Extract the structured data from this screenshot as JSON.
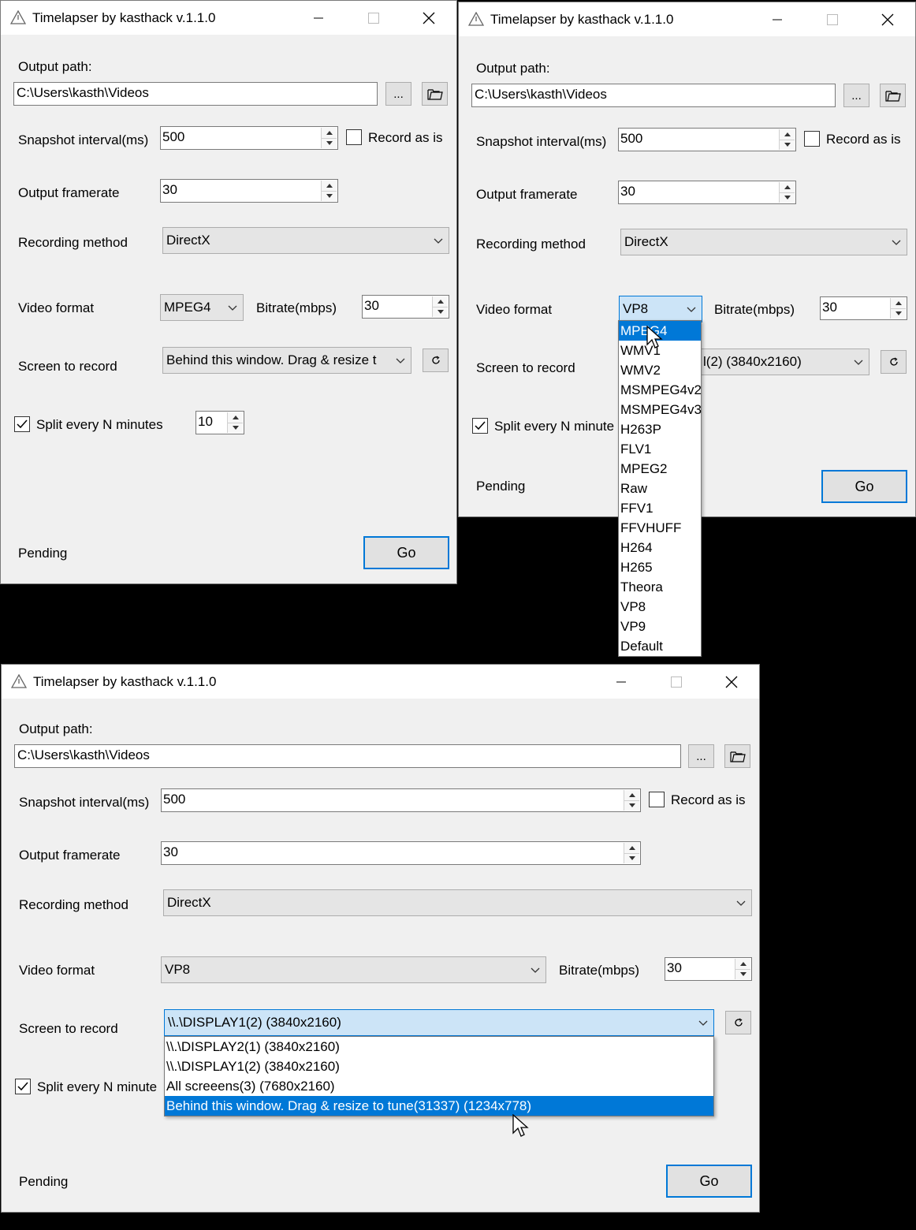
{
  "window_title": "Timelapser by kasthack v.1.1.0",
  "labels": {
    "output_path": "Output path:",
    "snapshot_interval": "Snapshot interval(ms)",
    "record_as_is": "Record as is",
    "output_framerate": "Output framerate",
    "recording_method": "Recording method",
    "video_format": "Video format",
    "bitrate": "Bitrate(mbps)",
    "screen_to_record": "Screen to record",
    "split_every": "Split every N minutes",
    "split_every_truncated": "Split every N minute",
    "browse_button": "...",
    "go_button": "Go",
    "status": "Pending"
  },
  "windows": [
    {
      "output_path": "C:\\Users\\kasth\\Videos",
      "snapshot_interval": "500",
      "output_framerate": "30",
      "recording_method": "DirectX",
      "video_format": "MPEG4",
      "bitrate": "30",
      "screen_to_record": "Behind this window. Drag & resize t",
      "split_minutes": "10",
      "record_as_is_checked": false,
      "split_checked": true
    },
    {
      "output_path": "C:\\Users\\kasth\\Videos",
      "snapshot_interval": "500",
      "output_framerate": "30",
      "recording_method": "DirectX",
      "video_format": "VP8",
      "bitrate": "30",
      "screen_to_record": "l(2) (3840x2160)",
      "video_format_options": [
        "MPEG4",
        "WMV1",
        "WMV2",
        "MSMPEG4v2",
        "MSMPEG4v3",
        "H263P",
        "FLV1",
        "MPEG2",
        "Raw",
        "FFV1",
        "FFVHUFF",
        "H264",
        "H265",
        "Theora",
        "VP8",
        "VP9",
        "Default"
      ],
      "highlighted_option": "MPEG4"
    },
    {
      "output_path": "C:\\Users\\kasth\\Videos",
      "snapshot_interval": "500",
      "output_framerate": "30",
      "recording_method": "DirectX",
      "video_format": "VP8",
      "bitrate": "30",
      "screen_to_record": "\\\\.\\DISPLAY1(2) (3840x2160)",
      "screen_options": [
        "\\\\.\\DISPLAY2(1) (3840x2160)",
        "\\\\.\\DISPLAY1(2) (3840x2160)",
        "All screeens(3) (7680x2160)",
        "Behind this window. Drag & resize to tune(31337) (1234x778)"
      ],
      "highlighted_option": "Behind this window. Drag & resize to tune(31337) (1234x778)"
    }
  ],
  "colors": {
    "accent": "#0078d7",
    "window_bg": "#f0f0f0",
    "titlebar_bg": "#ffffff"
  }
}
